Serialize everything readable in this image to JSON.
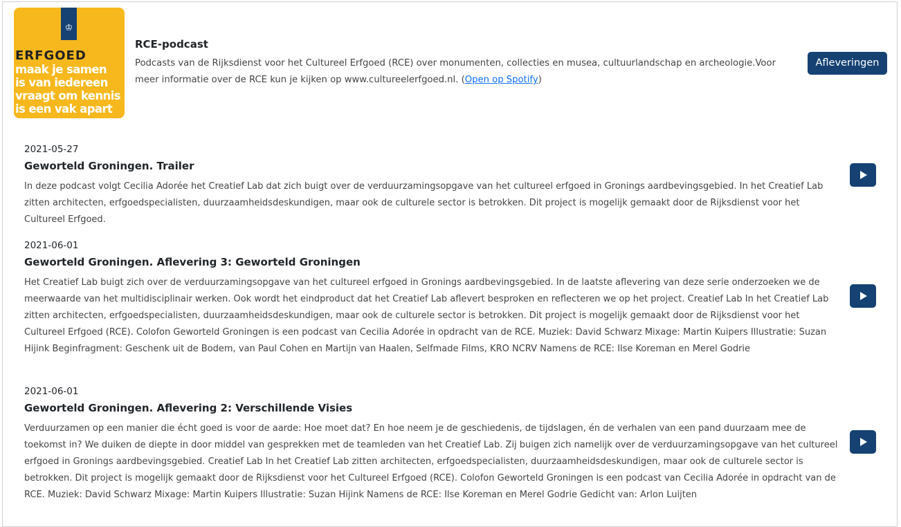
{
  "podcast": {
    "cover": {
      "brand": "ERFGOED",
      "slogan_lines": [
        "maak je samen",
        "is van iedereen",
        "vraagt om kennis",
        "is een vak apart"
      ],
      "icon": "royal-crest-icon",
      "colors": {
        "background": "#f7b81d",
        "band": "#154273"
      }
    },
    "title": "RCE-podcast",
    "description": "Podcasts van de Rijksdienst voor het Cultureel Erfgoed (RCE) over monumenten, collecties en musea, cultuurlandschap en archeologie.Voor meer informatie over de RCE kun je kijken op www.cultureelerfgoed.nl. (",
    "spotify_link": "Open op Spotify",
    "description_end": ")",
    "episodes_button": "Afleveringen"
  },
  "colors": {
    "accent": "#154273",
    "link": "#0d6efd"
  },
  "episodes": [
    {
      "date": "2021-05-27",
      "title": "Geworteld Groningen. Trailer",
      "description": "In deze podcast volgt Cecilia Adorée het Creatief Lab dat zich buigt over de verduurzamingsopgave van het cultureel erfgoed in Gronings aardbevingsgebied. In het Creatief Lab zitten architecten, erfgoedspecialisten, duurzaamheidsdeskundigen, maar ook de culturele sector is betrokken. Dit project is mogelijk gemaakt door de Rijksdienst voor het Cultureel Erfgoed.",
      "play_icon": "play-icon"
    },
    {
      "date": "2021-06-01",
      "title": "Geworteld Groningen. Aflevering 3: Geworteld Groningen",
      "description": "Het Creatief Lab buigt zich over de verduurzamingsopgave van het cultureel erfgoed in Gronings aardbevingsgebied. In de laatste aflevering van deze serie onderzoeken we de meerwaarde van het multidisciplinair werken. Ook wordt het eindproduct dat het Creatief Lab aflevert besproken en reflecteren we op het project. Creatief Lab In het Creatief Lab zitten architecten, erfgoedspecialisten, duurzaamheidsdeskundigen, maar ook de culturele sector is betrokken. Dit project is mogelijk gemaakt door de Rijksdienst voor het Cultureel Erfgoed (RCE). Colofon Geworteld Groningen is een podcast van Cecilia Adorée in opdracht van de RCE. Muziek: David Schwarz Mixage: Martin Kuipers Illustratie: Suzan Hijink Beginfragment: Geschenk uit de Bodem, van Paul Cohen en Martijn van Haalen, Selfmade Films, KRO NCRV Namens de RCE: Ilse Koreman en Merel Godrie",
      "play_icon": "play-icon"
    },
    {
      "date": "2021-06-01",
      "title": "Geworteld Groningen. Aflevering 2: Verschillende Visies",
      "description": "Verduurzamen op een manier die écht goed is voor de aarde: Hoe moet dat? En hoe neem je de geschiedenis, de tijdslagen, én de verhalen van een pand duurzaam mee de toekomst in? We duiken de diepte in door middel van gesprekken met de teamleden van het Creatief Lab. Zij buigen zich namelijk over de verduurzamingsopgave van het cultureel erfgoed in Gronings aardbevingsgebied. Creatief Lab In het Creatief Lab zitten architecten, erfgoedspecialisten, duurzaamheidsdeskundigen, maar ook de culturele sector is betrokken. Dit project is mogelijk gemaakt door de Rijksdienst voor het Cultureel Erfgoed (RCE). Colofon Geworteld Groningen is een podcast van Cecilia Adorée in opdracht van de RCE. Muziek: David Schwarz Mixage: Martin Kuipers Illustratie: Suzan Hijink Namens de RCE: Ilse Koreman en Merel Godrie Gedicht van: Arlon Luijten",
      "play_icon": "play-icon"
    }
  ]
}
